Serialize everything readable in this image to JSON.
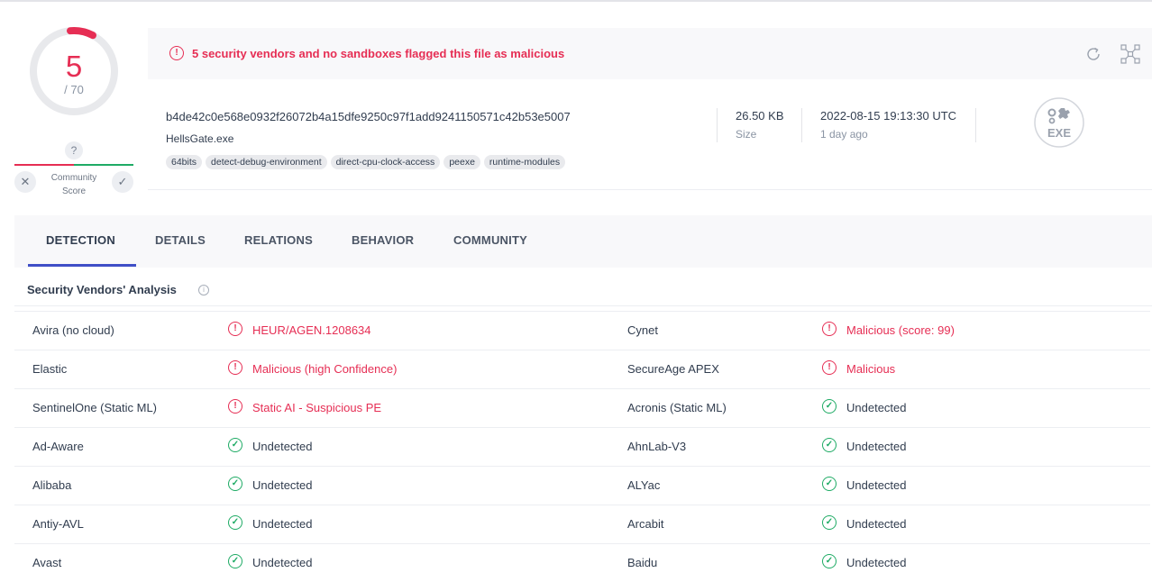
{
  "score": {
    "detections": "5",
    "total": "/ 70"
  },
  "community": {
    "question": "?",
    "label_line1": "Community",
    "label_line2": "Score",
    "dislike_icon": "x-icon",
    "like_icon": "check-icon"
  },
  "banner": {
    "text": "5 security vendors and no sandboxes flagged this file as malicious",
    "icon": "!"
  },
  "file": {
    "sha256": "b4de42c0e568e0932f26072b4a15dfe9250c97f1add9241150571c42b53e5007",
    "name": "HellsGate.exe",
    "tags": [
      "64bits",
      "detect-debug-environment",
      "direct-cpu-clock-access",
      "peexe",
      "runtime-modules"
    ],
    "size_value": "26.50 KB",
    "size_label": "Size",
    "date_value": "2022-08-15 19:13:30 UTC",
    "date_label": "1 day ago",
    "type_label": "EXE"
  },
  "tabs": [
    "DETECTION",
    "DETAILS",
    "RELATIONS",
    "BEHAVIOR",
    "COMMUNITY"
  ],
  "section": {
    "title": "Security Vendors' Analysis",
    "info": "i"
  },
  "colors": {
    "malicious": "#e62e54",
    "clean": "#1fab65",
    "accent": "#3f4fc7"
  },
  "rows": [
    {
      "left": {
        "vendor": "Avira (no cloud)",
        "result": "HEUR/AGEN.1208634",
        "status": "malicious"
      },
      "right": {
        "vendor": "Cynet",
        "result": "Malicious (score: 99)",
        "status": "malicious"
      }
    },
    {
      "left": {
        "vendor": "Elastic",
        "result": "Malicious (high Confidence)",
        "status": "malicious"
      },
      "right": {
        "vendor": "SecureAge APEX",
        "result": "Malicious",
        "status": "malicious"
      }
    },
    {
      "left": {
        "vendor": "SentinelOne (Static ML)",
        "result": "Static AI - Suspicious PE",
        "status": "malicious"
      },
      "right": {
        "vendor": "Acronis (Static ML)",
        "result": "Undetected",
        "status": "undetected"
      }
    },
    {
      "left": {
        "vendor": "Ad-Aware",
        "result": "Undetected",
        "status": "undetected"
      },
      "right": {
        "vendor": "AhnLab-V3",
        "result": "Undetected",
        "status": "undetected"
      }
    },
    {
      "left": {
        "vendor": "Alibaba",
        "result": "Undetected",
        "status": "undetected"
      },
      "right": {
        "vendor": "ALYac",
        "result": "Undetected",
        "status": "undetected"
      }
    },
    {
      "left": {
        "vendor": "Antiy-AVL",
        "result": "Undetected",
        "status": "undetected"
      },
      "right": {
        "vendor": "Arcabit",
        "result": "Undetected",
        "status": "undetected"
      }
    },
    {
      "left": {
        "vendor": "Avast",
        "result": "Undetected",
        "status": "undetected"
      },
      "right": {
        "vendor": "Baidu",
        "result": "Undetected",
        "status": "undetected"
      }
    }
  ]
}
